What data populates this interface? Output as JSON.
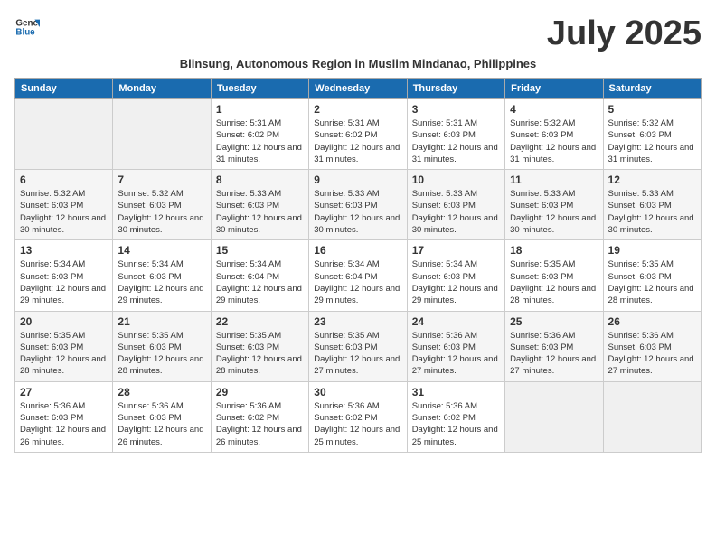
{
  "logo": {
    "line1": "General",
    "line2": "Blue"
  },
  "title": "July 2025",
  "subtitle": "Blinsung, Autonomous Region in Muslim Mindanao, Philippines",
  "weekdays": [
    "Sunday",
    "Monday",
    "Tuesday",
    "Wednesday",
    "Thursday",
    "Friday",
    "Saturday"
  ],
  "weeks": [
    [
      {
        "day": "",
        "info": ""
      },
      {
        "day": "",
        "info": ""
      },
      {
        "day": "1",
        "info": "Sunrise: 5:31 AM\nSunset: 6:02 PM\nDaylight: 12 hours and 31 minutes."
      },
      {
        "day": "2",
        "info": "Sunrise: 5:31 AM\nSunset: 6:02 PM\nDaylight: 12 hours and 31 minutes."
      },
      {
        "day": "3",
        "info": "Sunrise: 5:31 AM\nSunset: 6:03 PM\nDaylight: 12 hours and 31 minutes."
      },
      {
        "day": "4",
        "info": "Sunrise: 5:32 AM\nSunset: 6:03 PM\nDaylight: 12 hours and 31 minutes."
      },
      {
        "day": "5",
        "info": "Sunrise: 5:32 AM\nSunset: 6:03 PM\nDaylight: 12 hours and 31 minutes."
      }
    ],
    [
      {
        "day": "6",
        "info": "Sunrise: 5:32 AM\nSunset: 6:03 PM\nDaylight: 12 hours and 30 minutes."
      },
      {
        "day": "7",
        "info": "Sunrise: 5:32 AM\nSunset: 6:03 PM\nDaylight: 12 hours and 30 minutes."
      },
      {
        "day": "8",
        "info": "Sunrise: 5:33 AM\nSunset: 6:03 PM\nDaylight: 12 hours and 30 minutes."
      },
      {
        "day": "9",
        "info": "Sunrise: 5:33 AM\nSunset: 6:03 PM\nDaylight: 12 hours and 30 minutes."
      },
      {
        "day": "10",
        "info": "Sunrise: 5:33 AM\nSunset: 6:03 PM\nDaylight: 12 hours and 30 minutes."
      },
      {
        "day": "11",
        "info": "Sunrise: 5:33 AM\nSunset: 6:03 PM\nDaylight: 12 hours and 30 minutes."
      },
      {
        "day": "12",
        "info": "Sunrise: 5:33 AM\nSunset: 6:03 PM\nDaylight: 12 hours and 30 minutes."
      }
    ],
    [
      {
        "day": "13",
        "info": "Sunrise: 5:34 AM\nSunset: 6:03 PM\nDaylight: 12 hours and 29 minutes."
      },
      {
        "day": "14",
        "info": "Sunrise: 5:34 AM\nSunset: 6:03 PM\nDaylight: 12 hours and 29 minutes."
      },
      {
        "day": "15",
        "info": "Sunrise: 5:34 AM\nSunset: 6:04 PM\nDaylight: 12 hours and 29 minutes."
      },
      {
        "day": "16",
        "info": "Sunrise: 5:34 AM\nSunset: 6:04 PM\nDaylight: 12 hours and 29 minutes."
      },
      {
        "day": "17",
        "info": "Sunrise: 5:34 AM\nSunset: 6:03 PM\nDaylight: 12 hours and 29 minutes."
      },
      {
        "day": "18",
        "info": "Sunrise: 5:35 AM\nSunset: 6:03 PM\nDaylight: 12 hours and 28 minutes."
      },
      {
        "day": "19",
        "info": "Sunrise: 5:35 AM\nSunset: 6:03 PM\nDaylight: 12 hours and 28 minutes."
      }
    ],
    [
      {
        "day": "20",
        "info": "Sunrise: 5:35 AM\nSunset: 6:03 PM\nDaylight: 12 hours and 28 minutes."
      },
      {
        "day": "21",
        "info": "Sunrise: 5:35 AM\nSunset: 6:03 PM\nDaylight: 12 hours and 28 minutes."
      },
      {
        "day": "22",
        "info": "Sunrise: 5:35 AM\nSunset: 6:03 PM\nDaylight: 12 hours and 28 minutes."
      },
      {
        "day": "23",
        "info": "Sunrise: 5:35 AM\nSunset: 6:03 PM\nDaylight: 12 hours and 27 minutes."
      },
      {
        "day": "24",
        "info": "Sunrise: 5:36 AM\nSunset: 6:03 PM\nDaylight: 12 hours and 27 minutes."
      },
      {
        "day": "25",
        "info": "Sunrise: 5:36 AM\nSunset: 6:03 PM\nDaylight: 12 hours and 27 minutes."
      },
      {
        "day": "26",
        "info": "Sunrise: 5:36 AM\nSunset: 6:03 PM\nDaylight: 12 hours and 27 minutes."
      }
    ],
    [
      {
        "day": "27",
        "info": "Sunrise: 5:36 AM\nSunset: 6:03 PM\nDaylight: 12 hours and 26 minutes."
      },
      {
        "day": "28",
        "info": "Sunrise: 5:36 AM\nSunset: 6:03 PM\nDaylight: 12 hours and 26 minutes."
      },
      {
        "day": "29",
        "info": "Sunrise: 5:36 AM\nSunset: 6:02 PM\nDaylight: 12 hours and 26 minutes."
      },
      {
        "day": "30",
        "info": "Sunrise: 5:36 AM\nSunset: 6:02 PM\nDaylight: 12 hours and 25 minutes."
      },
      {
        "day": "31",
        "info": "Sunrise: 5:36 AM\nSunset: 6:02 PM\nDaylight: 12 hours and 25 minutes."
      },
      {
        "day": "",
        "info": ""
      },
      {
        "day": "",
        "info": ""
      }
    ]
  ]
}
